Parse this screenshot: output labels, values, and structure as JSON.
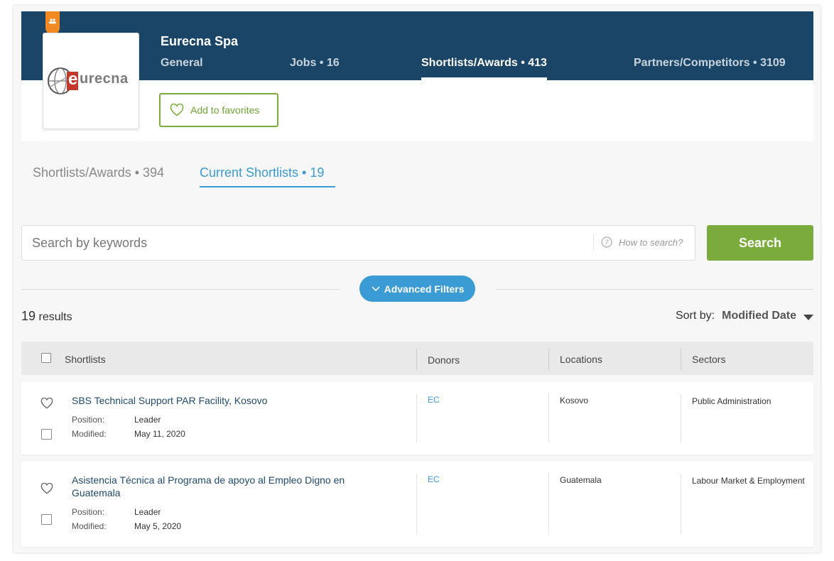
{
  "company": {
    "name": "Eurecna Spa",
    "logo_text": "urecna",
    "logo_letter": "e"
  },
  "header_tabs": [
    {
      "label": "General",
      "active": false
    },
    {
      "label": "Jobs • 16",
      "active": false
    },
    {
      "label": "Shortlists/Awards • 413",
      "active": true
    },
    {
      "label": "Partners/Competitors • 3109",
      "active": false
    }
  ],
  "favorites": {
    "label": "Add to favorites"
  },
  "sub_tabs": [
    {
      "label": "Shortlists/Awards • 394",
      "active": false
    },
    {
      "label": "Current Shortlists • 19",
      "active": true
    }
  ],
  "search": {
    "placeholder": "Search by keywords",
    "how_label": "How to search?",
    "button_label": "Search"
  },
  "filters": {
    "label": "Advanced Filters"
  },
  "results": {
    "count": "19",
    "label": "results"
  },
  "sort": {
    "label": "Sort by:",
    "value": "Modified Date"
  },
  "table": {
    "headers": [
      "Shortlists",
      "Donors",
      "Locations",
      "Sectors"
    ],
    "rows": [
      {
        "title": "SBS Technical Support PAR Facility, Kosovo",
        "position_label": "Position:",
        "position": "Leader",
        "modified_label": "Modified:",
        "modified": "May 11, 2020",
        "donor": "EC",
        "location": "Kosovo",
        "sector": "Public Administration"
      },
      {
        "title": "Asistencia Técnica al Programa de apoyo al Empleo Digno en Guatemala",
        "position_label": "Position:",
        "position": "Leader",
        "modified_label": "Modified:",
        "modified": "May 5, 2020",
        "donor": "EC",
        "location": "Guatemala",
        "sector": "Labour Market & Employment"
      }
    ]
  },
  "colors": {
    "header_bg": "#1a4566",
    "accent_green": "#7bab3d",
    "accent_blue": "#3a9bd5",
    "ribbon_orange": "#f28a24"
  }
}
